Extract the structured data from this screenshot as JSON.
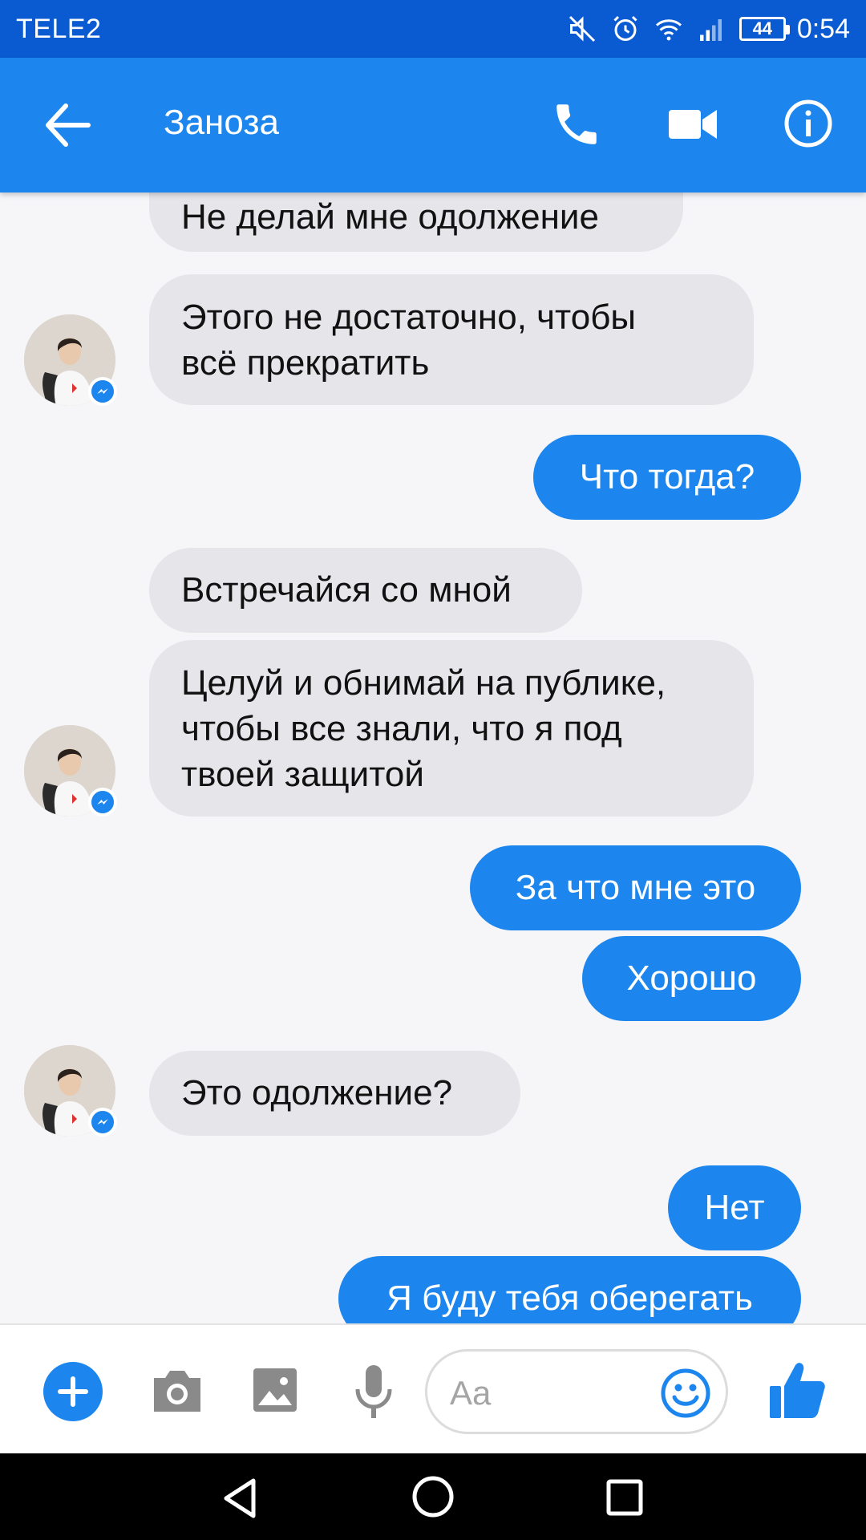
{
  "status_bar": {
    "carrier": "TELE2",
    "battery": "44",
    "time": "0:54"
  },
  "header": {
    "title": "Заноза",
    "back_icon": "arrow-left-icon",
    "call_icon": "phone-icon",
    "video_icon": "video-camera-icon",
    "info_icon": "info-icon"
  },
  "messages": [
    {
      "side": "in",
      "lines": [
        "Не делай мне одолжение"
      ]
    },
    {
      "side": "in",
      "lines": [
        "Этого не достаточно, чтобы",
        "всё прекратить"
      ]
    },
    {
      "side": "out",
      "lines": [
        "Что тогда?"
      ]
    },
    {
      "side": "in",
      "lines": [
        "Встречайся со мной"
      ]
    },
    {
      "side": "in",
      "lines": [
        "Целуй и обнимай на публике,",
        "чтобы все знали, что я под",
        "твоей защитой"
      ]
    },
    {
      "side": "out",
      "lines": [
        "За что мне это"
      ]
    },
    {
      "side": "out",
      "lines": [
        "Хорошо"
      ]
    },
    {
      "side": "in",
      "lines": [
        "Это одолжение?"
      ]
    },
    {
      "side": "out",
      "lines": [
        "Нет"
      ]
    },
    {
      "side": "out",
      "lines": [
        "Я буду тебя оберегать"
      ]
    }
  ],
  "composer": {
    "placeholder": "Aa"
  },
  "colors": {
    "status_bar": "#0a5bd1",
    "header": "#1c86ee",
    "outgoing_bubble": "#1c86ee",
    "incoming_bubble": "#e6e5ea",
    "background": "#f6f5f8"
  }
}
